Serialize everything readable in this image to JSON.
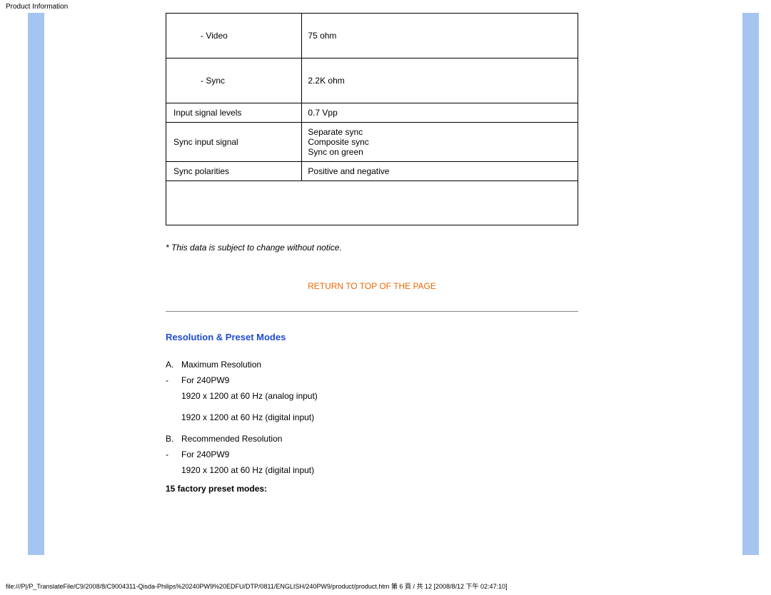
{
  "header": {
    "title": "Product Information"
  },
  "table": {
    "rows": [
      {
        "label": "        - Video",
        "value": "75 ohm",
        "indent": true,
        "tall": true
      },
      {
        "label": "        - Sync",
        "value": "2.2K ohm",
        "indent": true,
        "tall": true
      },
      {
        "label": "Input signal levels",
        "value": "0.7 Vpp"
      },
      {
        "label": "Sync input signal",
        "value": "Separate sync\nComposite sync\nSync on green"
      },
      {
        "label": "Sync polarities",
        "value": "Positive and negative"
      }
    ]
  },
  "notice": "* This data is subject to change without notice.",
  "return_link": "RETURN TO TOP OF THE PAGE",
  "section": {
    "title": "Resolution & Preset Modes"
  },
  "resolution": {
    "a_marker": "A.",
    "a_label": "Maximum Resolution",
    "a_sub_marker": "-",
    "a_sub_label": "For 240PW9",
    "a_line1": "1920 x 1200 at 60 Hz (analog input)",
    "a_line2": "1920 x 1200 at 60 Hz (digital input)",
    "b_marker": "B.",
    "b_label": "Recommended Resolution",
    "b_sub_marker": "-",
    "b_sub_label": "For 240PW9",
    "b_line1": "1920 x 1200 at 60 Hz (digital input)"
  },
  "preset": "15 factory preset modes:",
  "footer": "file:///P|/P_TranslateFile/C9/2008/8/C9004311-Qisda-Philips%20240PW9%20EDFU/DTP/0811/ENGLISH/240PW9/product/product.htm 第 6 頁 / 共 12  [2008/8/12 下午 02:47:10]"
}
